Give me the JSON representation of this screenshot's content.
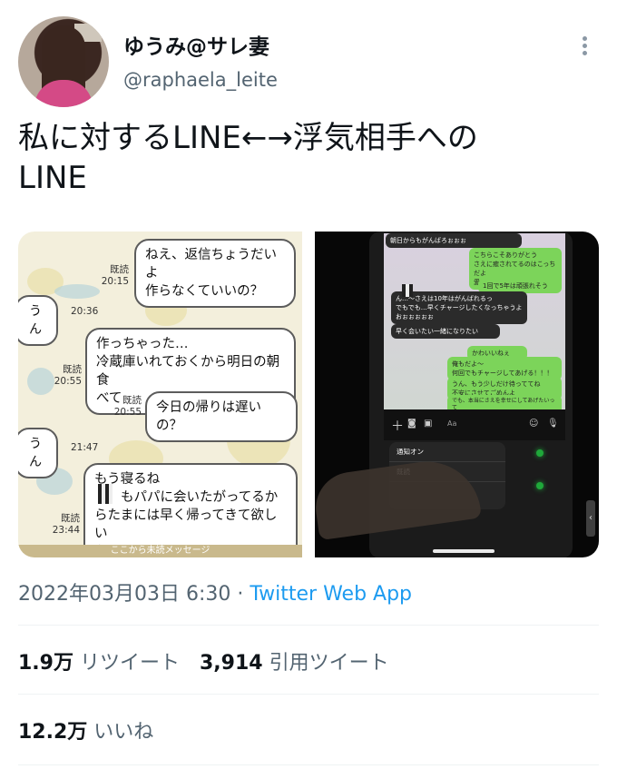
{
  "user": {
    "display_name": "ゆうみ@サレ妻",
    "handle": "@raphaela_leite"
  },
  "tweet": {
    "text": "私に対するLINE←→浮気相手への\nLINE"
  },
  "image_left": {
    "bubble1": "ねえ、返信ちょうだいよ\n作らなくていいの？",
    "meta1": "既読\n20:15",
    "bubble2": "うん",
    "meta2": "20:36",
    "bubble3": "作っちゃった…\n冷蔵庫いれておくから明日の朝食\nべて",
    "meta3": "既読\n20:55",
    "bubble4": "今日の帰りは遅いの？",
    "meta4": "既読\n20:55",
    "bubble5": "うん",
    "meta5": "21:47",
    "bubble6": "もう寝るね\n　　もパパに会いたがってるか\nらたまには早く帰ってきて欲しい\nな",
    "meta6": "既読\n23:44",
    "bottom_band": "ここから未読メッセージ"
  },
  "image_right": {
    "line1": "朝日からもがんばろぉぉぉ",
    "line2": "こちらこそありがとう\nさえに癒されてるのはこっちだよ\n愛してる",
    "line3": "1回で5年は頑張れそう",
    "line4": "ん…〜さえは10年はがんばれるっ\nでもでも…早くチャージしたくなっちゃうよ\nおぉぉぉぉぉ",
    "line5": "早く会いたい一緒になりたい",
    "line6": "かわいいねぇ",
    "line7": "俺もだよ〜\n何回でもチャージしてあげる！！！",
    "line8": "うん、もう少しだけ待っててね\n不安にさせてごめんよ",
    "line9": "でも、本当にさえを幸せにしてあげたいって\n気持ちはわかって欲しいな",
    "input_placeholder": "Aa",
    "menu1": "通知オン",
    "menu2": "既読"
  },
  "timestamp": {
    "datetime": "2022年03月03日 6:30 · ",
    "source": "Twitter Web App"
  },
  "stats": {
    "retweets_count": "1.9万",
    "retweets_label": "リツイート",
    "quotes_count": "3,914",
    "quotes_label": "引用ツイート",
    "likes_count": "12.2万",
    "likes_label": "いいね"
  }
}
